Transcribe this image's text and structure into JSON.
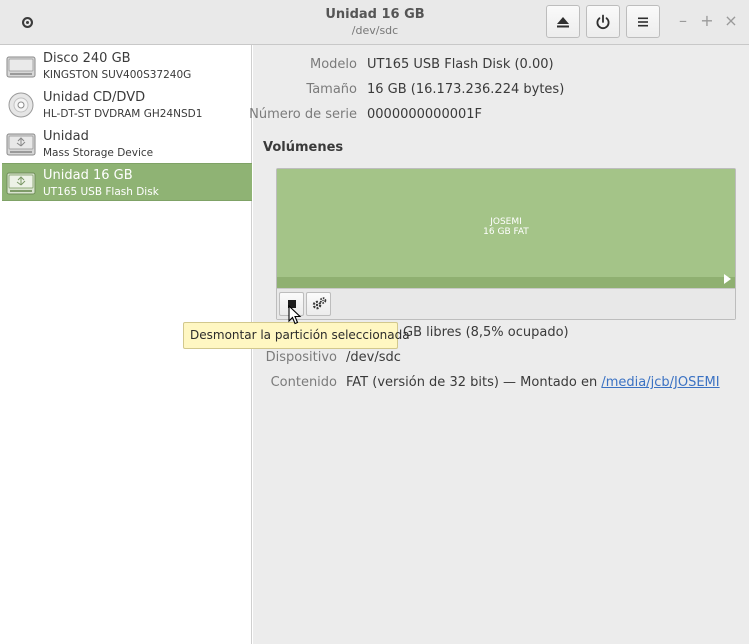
{
  "window": {
    "title": "Unidad 16 GB",
    "subtitle": "/dev/sdc"
  },
  "header": {
    "app_menu_icon": "app-menu-icon",
    "eject_icon": "eject-icon",
    "power_icon": "power-icon",
    "menu_icon": "hamburger-menu-icon",
    "minimize": "–",
    "maximize": "+",
    "close": "×"
  },
  "sidebar": {
    "items": [
      {
        "name": "Disco 240 GB",
        "model": "KINGSTON SUV400S37240G",
        "icon": "hard-disk-icon",
        "selected": false
      },
      {
        "name": "Unidad CD/DVD",
        "model": "HL-DT-ST DVDRAM GH24NSD1",
        "icon": "optical-disc-icon",
        "selected": false
      },
      {
        "name": "Unidad",
        "model": "Mass Storage Device",
        "icon": "usb-drive-icon",
        "selected": false
      },
      {
        "name": "Unidad 16 GB",
        "model": "UT165 USB Flash Disk",
        "icon": "usb-drive-icon",
        "selected": true
      }
    ]
  },
  "details": {
    "modelo_label": "Modelo",
    "modelo_value": "UT165 USB Flash Disk (0.00)",
    "tamano_label": "Tamaño",
    "tamano_value": "16 GB (16.173.236.224 bytes)",
    "serie_label": "Número de serie",
    "serie_value": "0000000000001F"
  },
  "volumes": {
    "section_title": "Volúmenes",
    "partition_name": "JOSEMI",
    "partition_size": "16 GB FAT",
    "usage_fraction": 0.085,
    "accent_color": "#a4c488"
  },
  "partition_info": {
    "size_value_visible": "GB libres (8,5% ocupado)",
    "dispositivo_label": "Dispositivo",
    "dispositivo_value": "/dev/sdc",
    "contenido_label": "Contenido",
    "contenido_value": "FAT (versión de 32 bits) — Montado en",
    "mount_link": "/media/jcb/JOSEMI"
  },
  "tooltip": {
    "text": "Desmontar la partición seleccionada"
  }
}
